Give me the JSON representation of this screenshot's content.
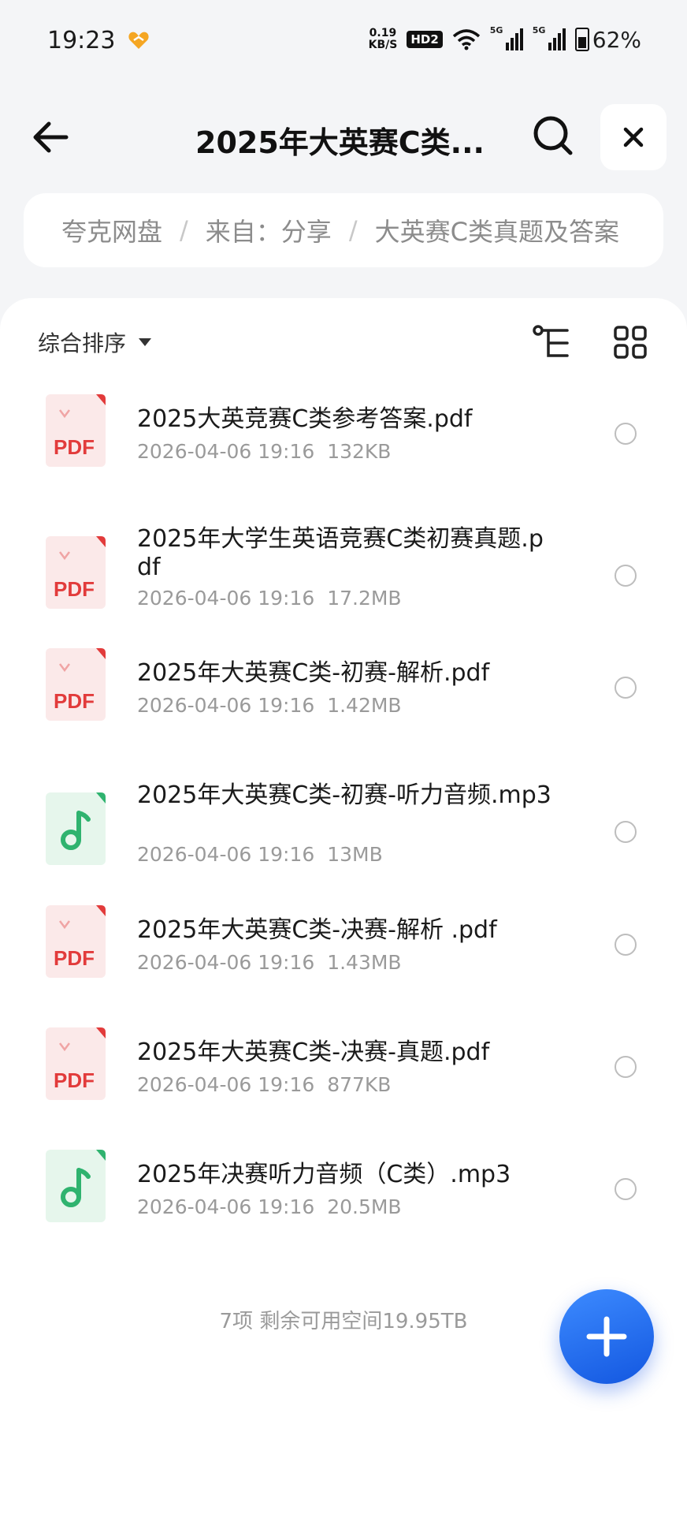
{
  "status_bar": {
    "time": "19:23",
    "net_speed_value": "0.19",
    "net_speed_unit": "KB/S",
    "hd_badge": "HD2",
    "sim1_label": "5G",
    "sim2_label": "5G",
    "battery": "62%",
    "battery_level": 0.62,
    "app_icon": "heart-icon"
  },
  "header": {
    "title": "2025年大英赛C类...",
    "back_icon": "arrow-left-icon",
    "search_icon": "search-icon",
    "close_icon": "close-icon"
  },
  "breadcrumb": {
    "items": [
      "夸克网盘",
      "来自：分享",
      "大英赛C类真题及答案"
    ],
    "separator": "/"
  },
  "toolbar": {
    "sort_label": "综合排序",
    "tree_icon": "tree-view-icon",
    "grid_icon": "grid-view-icon"
  },
  "files": [
    {
      "name": "2025大英竞赛C类参考答案.pdf",
      "date": "2026-04-06 19:16",
      "size": "132KB",
      "type": "pdf",
      "icon_label": "PDF"
    },
    {
      "name": "2025年大学生英语竞赛C类初赛真题.pdf",
      "date": "2026-04-06 19:16",
      "size": "17.2MB",
      "type": "pdf",
      "icon_label": "PDF"
    },
    {
      "name": "2025年大英赛C类-初赛-解析.pdf",
      "date": "2026-04-06 19:16",
      "size": "1.42MB",
      "type": "pdf",
      "icon_label": "PDF"
    },
    {
      "name": "2025年大英赛C类-初赛-听力音频.mp3",
      "date": "2026-04-06 19:16",
      "size": "13MB",
      "type": "audio",
      "icon_label": ""
    },
    {
      "name": "2025年大英赛C类-决赛-解析 .pdf",
      "date": "2026-04-06 19:16",
      "size": "1.43MB",
      "type": "pdf",
      "icon_label": "PDF"
    },
    {
      "name": "2025年大英赛C类-决赛-真题.pdf",
      "date": "2026-04-06 19:16",
      "size": "877KB",
      "type": "pdf",
      "icon_label": "PDF"
    },
    {
      "name": "2025年决赛听力音频（C类）.mp3",
      "date": "2026-04-06 19:16",
      "size": "20.5MB",
      "type": "audio",
      "icon_label": ""
    }
  ],
  "footer": {
    "summary": "7项 剩余可用空间19.95TB"
  },
  "fab": {
    "icon": "plus-icon"
  },
  "colors": {
    "pdf_red": "#e23b3b",
    "audio_green": "#2fb36f",
    "fab_blue": "#1f6bf0"
  }
}
